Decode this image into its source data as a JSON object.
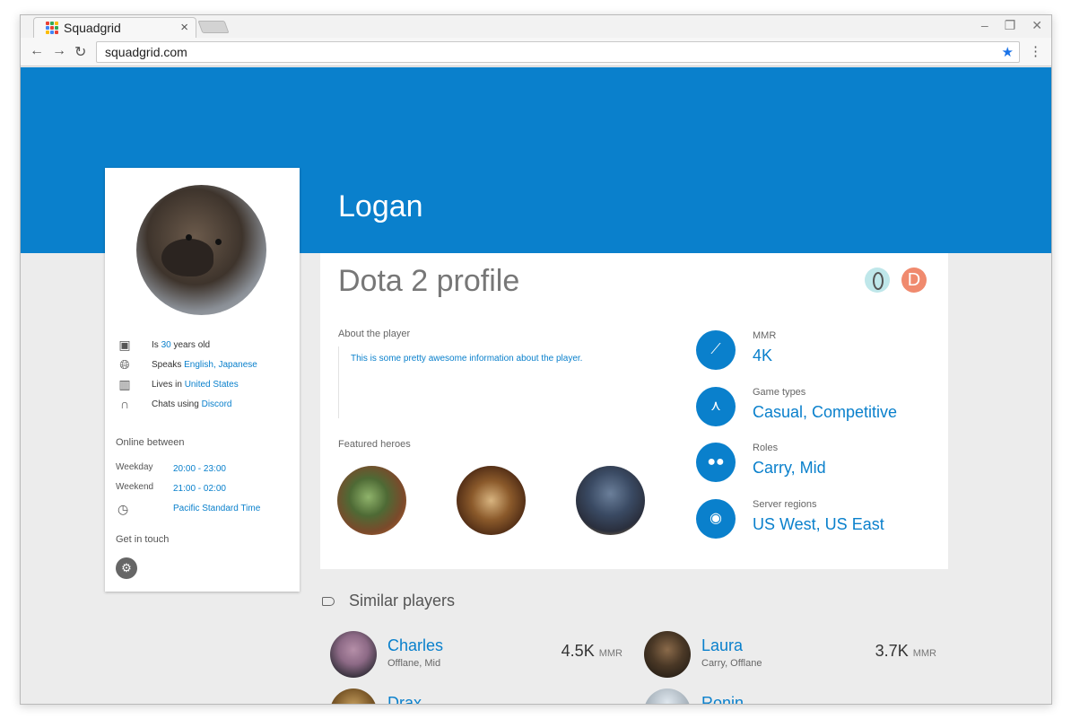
{
  "browser": {
    "tab_title": "Squadgrid",
    "tab_close": "×",
    "url": "squadgrid.com",
    "window_controls": [
      "–",
      "❐",
      "✕"
    ],
    "favicon_colors": [
      "#e94235",
      "#34a853",
      "#fbbc05",
      "#4285f4",
      "#e94235",
      "#34a853",
      "#fbbc05",
      "#4285f4",
      "#e94235"
    ]
  },
  "player": {
    "name": "Logan",
    "age_prefix": "Is ",
    "age": "30",
    "age_suffix": " years old",
    "speaks_prefix": "Speaks ",
    "languages": "English, Japanese",
    "lives_prefix": "Lives in ",
    "country": "United States",
    "chats_prefix": "Chats using ",
    "chat_app": "Discord"
  },
  "schedule": {
    "title": "Online between",
    "weekday_label": "Weekday",
    "weekday_value": "20:00 - 23:00",
    "weekend_label": "Weekend",
    "weekend_value": "21:00 - 02:00",
    "timezone": "Pacific Standard Time"
  },
  "contact": {
    "title": "Get in touch"
  },
  "profile": {
    "title": "Dota 2 profile",
    "badge2_letter": "D",
    "about_label": "About the player",
    "about_text": "This is some pretty awesome information about the player.",
    "heroes_label": "Featured heroes",
    "stats": [
      {
        "label": "MMR",
        "value": "4K",
        "icon": "trending-icon"
      },
      {
        "label": "Game types",
        "value": "Casual, Competitive",
        "icon": "game-types-icon"
      },
      {
        "label": "Roles",
        "value": "Carry, Mid",
        "icon": "people-icon"
      },
      {
        "label": "Server regions",
        "value": "US West, US East",
        "icon": "globe-icon"
      }
    ]
  },
  "similar": {
    "title": "Similar players",
    "players": [
      {
        "name": "Charles",
        "roles": "Offlane, Mid",
        "mmr": "4.5K",
        "unit": "MMR"
      },
      {
        "name": "Laura",
        "roles": "Carry, Offlane",
        "mmr": "3.7K",
        "unit": "MMR"
      },
      {
        "name": "Drax"
      },
      {
        "name": "Ronin"
      }
    ]
  },
  "colors": {
    "accent": "#0a80cc",
    "hero_bg": "#0a80cc"
  }
}
